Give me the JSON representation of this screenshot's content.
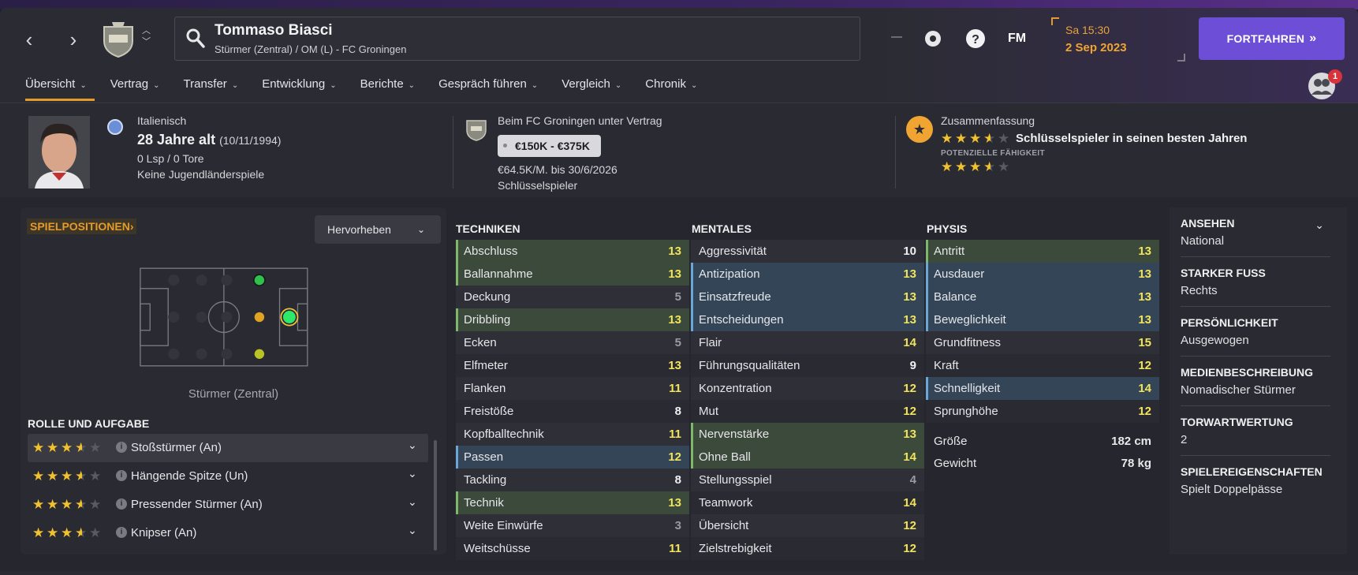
{
  "header": {
    "player_name": "Tommaso Biasci",
    "player_sub": "Stürmer (Zentral) / OM (L) - FC Groningen",
    "day_time": "Sa 15:30",
    "date": "2 Sep 2023",
    "continue_label": "FORTFAHREN",
    "fm_label": "FM",
    "notification_count": "1",
    "accent": "#6d4ed6"
  },
  "tabs": [
    {
      "label": "Übersicht"
    },
    {
      "label": "Vertrag"
    },
    {
      "label": "Transfer"
    },
    {
      "label": "Entwicklung"
    },
    {
      "label": "Berichte"
    },
    {
      "label": "Gespräch führen"
    },
    {
      "label": "Vergleich"
    },
    {
      "label": "Chronik"
    }
  ],
  "info": {
    "nationality": "Italienisch",
    "age": "28 Jahre alt",
    "dob": "(10/11/1994)",
    "apps": "0 Lsp / 0 Tore",
    "youth": "Keine Jugendländerspiele",
    "contract": "Beim FC Groningen unter Vertrag",
    "value": "€150K - €375K",
    "wage": "€64.5K/M. bis 30/6/2026",
    "squad_role": "Schlüsselspieler",
    "summary_label": "Zusammenfassung",
    "summary_text": "Schlüsselspieler in seinen besten Jahren",
    "potential_label": "POTENZIELLE FÄHIGKEIT",
    "current_ability_stars": 3.5,
    "potential_ability_stars": 3.5
  },
  "positions": {
    "label": "SPIELPOSITIONEN",
    "highlight_label": "Hervorheben",
    "position_name": "Stürmer (Zentral)",
    "role_label": "ROLLE UND AUFGABE",
    "roles": [
      {
        "name": "Stoßstürmer (An)",
        "stars": 3.5
      },
      {
        "name": "Hängende Spitze (Un)",
        "stars": 3.5
      },
      {
        "name": "Pressender Stürmer (An)",
        "stars": 3.5
      },
      {
        "name": "Knipser (An)",
        "stars": 3.5
      }
    ]
  },
  "attributes": {
    "technical_label": "TECHNIKEN",
    "mental_label": "MENTALES",
    "physical_label": "PHYSIS",
    "technical": [
      {
        "name": "Abschluss",
        "value": "13",
        "hl": "g"
      },
      {
        "name": "Ballannahme",
        "value": "13",
        "hl": "g"
      },
      {
        "name": "Deckung",
        "value": "5",
        "hl": ""
      },
      {
        "name": "Dribbling",
        "value": "13",
        "hl": "g"
      },
      {
        "name": "Ecken",
        "value": "5",
        "hl": ""
      },
      {
        "name": "Elfmeter",
        "value": "13",
        "hl": ""
      },
      {
        "name": "Flanken",
        "value": "11",
        "hl": ""
      },
      {
        "name": "Freistöße",
        "value": "8",
        "hl": ""
      },
      {
        "name": "Kopfballtechnik",
        "value": "11",
        "hl": ""
      },
      {
        "name": "Passen",
        "value": "12",
        "hl": "b"
      },
      {
        "name": "Tackling",
        "value": "8",
        "hl": ""
      },
      {
        "name": "Technik",
        "value": "13",
        "hl": "g"
      },
      {
        "name": "Weite Einwürfe",
        "value": "3",
        "hl": ""
      },
      {
        "name": "Weitschüsse",
        "value": "11",
        "hl": ""
      }
    ],
    "mental": [
      {
        "name": "Aggressivität",
        "value": "10",
        "hl": ""
      },
      {
        "name": "Antizipation",
        "value": "13",
        "hl": "b"
      },
      {
        "name": "Einsatzfreude",
        "value": "13",
        "hl": "b"
      },
      {
        "name": "Entscheidungen",
        "value": "13",
        "hl": "b"
      },
      {
        "name": "Flair",
        "value": "14",
        "hl": ""
      },
      {
        "name": "Führungsqualitäten",
        "value": "9",
        "hl": ""
      },
      {
        "name": "Konzentration",
        "value": "12",
        "hl": ""
      },
      {
        "name": "Mut",
        "value": "12",
        "hl": ""
      },
      {
        "name": "Nervenstärke",
        "value": "13",
        "hl": "g"
      },
      {
        "name": "Ohne Ball",
        "value": "14",
        "hl": "g"
      },
      {
        "name": "Stellungsspiel",
        "value": "4",
        "hl": ""
      },
      {
        "name": "Teamwork",
        "value": "14",
        "hl": ""
      },
      {
        "name": "Übersicht",
        "value": "12",
        "hl": ""
      },
      {
        "name": "Zielstrebigkeit",
        "value": "12",
        "hl": ""
      }
    ],
    "physical": [
      {
        "name": "Antritt",
        "value": "13",
        "hl": "g"
      },
      {
        "name": "Ausdauer",
        "value": "13",
        "hl": "b"
      },
      {
        "name": "Balance",
        "value": "13",
        "hl": "b"
      },
      {
        "name": "Beweglichkeit",
        "value": "13",
        "hl": "b"
      },
      {
        "name": "Grundfitness",
        "value": "15",
        "hl": ""
      },
      {
        "name": "Kraft",
        "value": "12",
        "hl": ""
      },
      {
        "name": "Schnelligkeit",
        "value": "14",
        "hl": "b"
      },
      {
        "name": "Sprunghöhe",
        "value": "12",
        "hl": ""
      }
    ],
    "height_label": "Größe",
    "height": "182 cm",
    "weight_label": "Gewicht",
    "weight": "78 kg"
  },
  "side": [
    {
      "title": "ANSEHEN",
      "value": "National"
    },
    {
      "title": "STARKER FUSS",
      "value": "Rechts"
    },
    {
      "title": "PERSÖNLICHKEIT",
      "value": "Ausgewogen"
    },
    {
      "title": "MEDIENBESCHREIBUNG",
      "value": "Nomadischer Stürmer"
    },
    {
      "title": "TORWARTWERTUNG",
      "value": "2"
    },
    {
      "title": "SPIELEREIGENSCHAFTEN",
      "value": "Spielt Doppelpässe"
    }
  ],
  "colors": {
    "high": "#f2e45a",
    "mid": "#f0f0f2",
    "low": "#9a9aa2",
    "orange": "#e59a2c"
  }
}
